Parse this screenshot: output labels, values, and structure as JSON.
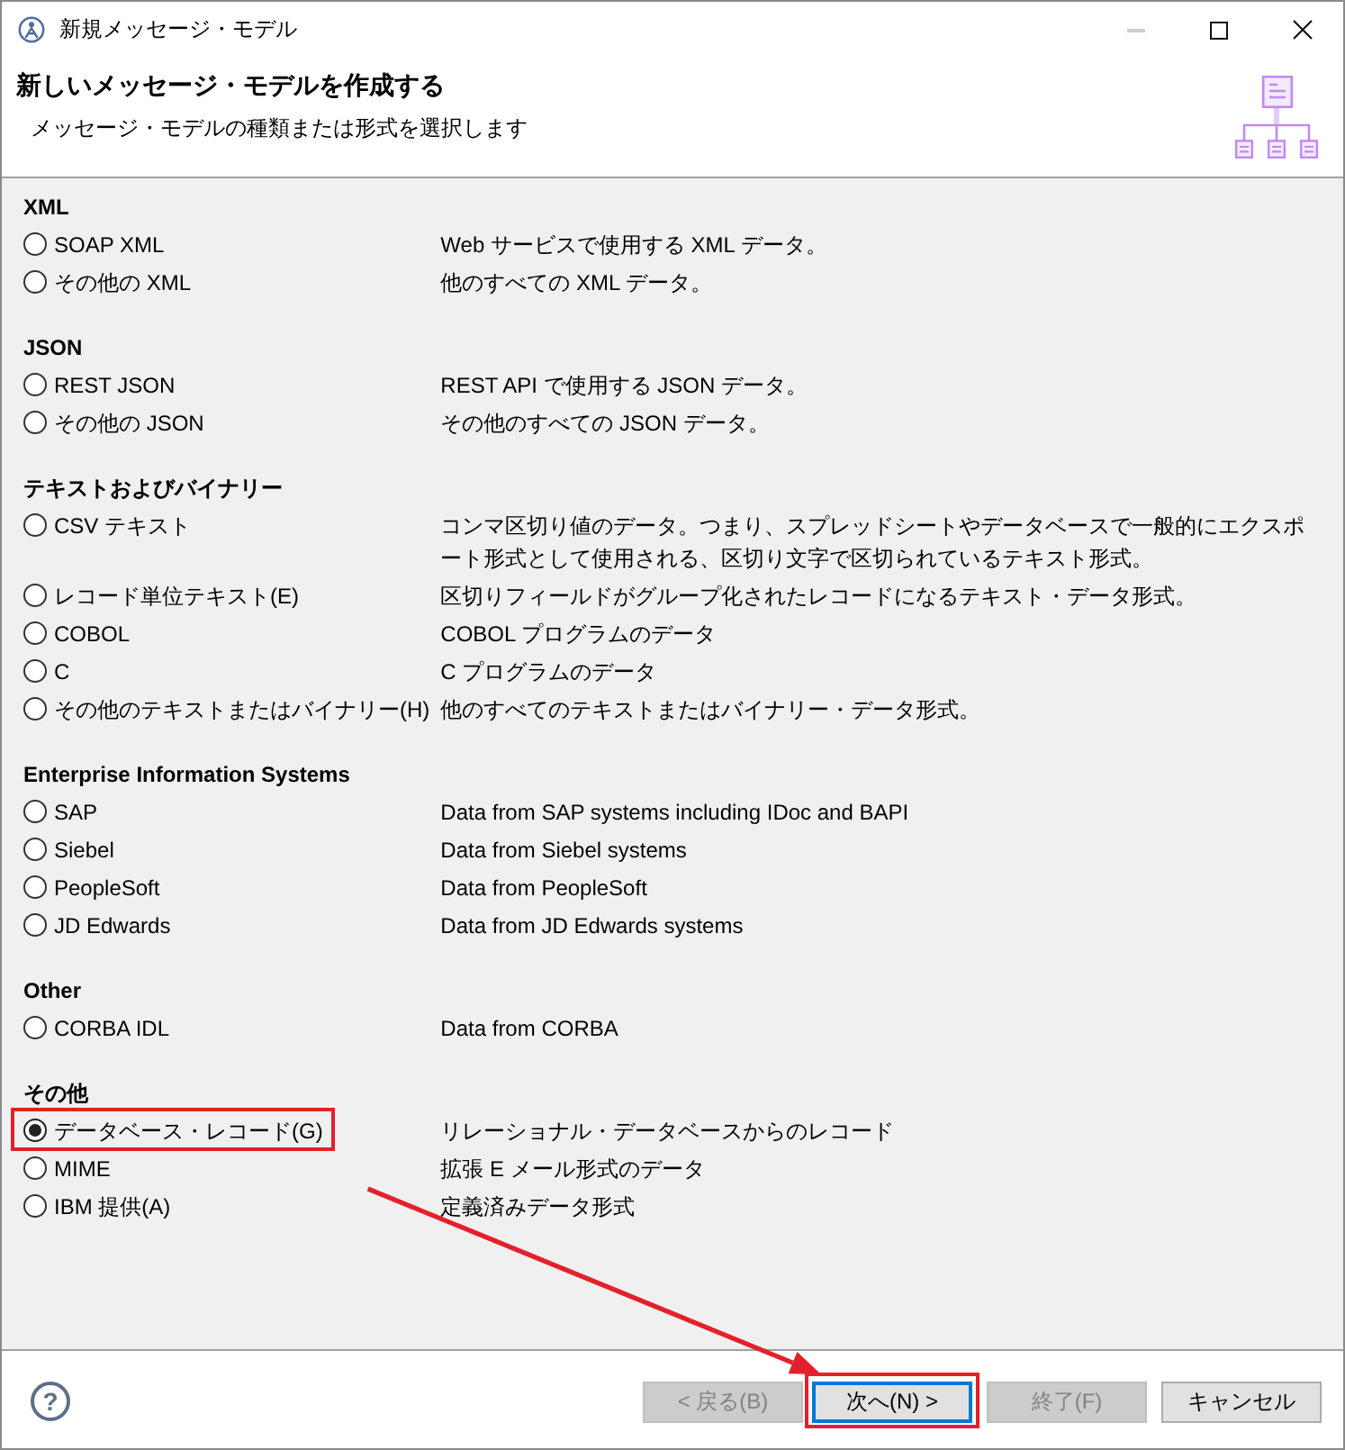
{
  "window": {
    "title": "新規メッセージ・モデル",
    "controls": [
      {
        "kind": "minimize",
        "disabled": true
      },
      {
        "kind": "maximize",
        "disabled": false
      },
      {
        "kind": "close",
        "disabled": false
      }
    ]
  },
  "header": {
    "title": "新しいメッセージ・モデルを作成する",
    "subtitle": "メッセージ・モデルの種類または形式を選択します"
  },
  "groups": [
    {
      "heading": "XML",
      "options": [
        {
          "label": "SOAP XML",
          "description": "Web サービスで使用する XML データ。",
          "selected": false,
          "highlighted": false
        },
        {
          "label": "その他の XML",
          "description": "他のすべての XML データ。",
          "selected": false,
          "highlighted": false
        }
      ]
    },
    {
      "heading": "JSON",
      "options": [
        {
          "label": "REST JSON",
          "description": "REST API で使用する JSON データ。",
          "selected": false,
          "highlighted": false
        },
        {
          "label": "その他の JSON",
          "description": "その他のすべての JSON データ。",
          "selected": false,
          "highlighted": false
        }
      ]
    },
    {
      "heading": "テキストおよびバイナリー",
      "options": [
        {
          "label": "CSV テキスト",
          "description": "コンマ区切り値のデータ。つまり、スプレッドシートやデータベースで一般的にエクスポート形式として使用される、区切り文字で区切られているテキスト形式。",
          "selected": false,
          "highlighted": false
        },
        {
          "label": "レコード単位テキスト(E)",
          "description": "区切りフィールドがグループ化されたレコードになるテキスト・データ形式。",
          "selected": false,
          "highlighted": false
        },
        {
          "label": "COBOL",
          "description": "COBOL プログラムのデータ",
          "selected": false,
          "highlighted": false
        },
        {
          "label": "C",
          "description": "C プログラムのデータ",
          "selected": false,
          "highlighted": false
        },
        {
          "label": "その他のテキストまたはバイナリー(H)",
          "description": "他のすべてのテキストまたはバイナリー・データ形式。",
          "selected": false,
          "highlighted": false
        }
      ]
    },
    {
      "heading": "Enterprise Information Systems",
      "options": [
        {
          "label": "SAP",
          "description": "Data from SAP systems including IDoc and BAPI",
          "selected": false,
          "highlighted": false
        },
        {
          "label": "Siebel",
          "description": "Data from Siebel systems",
          "selected": false,
          "highlighted": false
        },
        {
          "label": "PeopleSoft",
          "description": "Data from PeopleSoft",
          "selected": false,
          "highlighted": false
        },
        {
          "label": "JD Edwards",
          "description": "Data from JD Edwards systems",
          "selected": false,
          "highlighted": false
        }
      ]
    },
    {
      "heading": "Other",
      "options": [
        {
          "label": "CORBA IDL",
          "description": "Data from CORBA",
          "selected": false,
          "highlighted": false
        }
      ]
    },
    {
      "heading": "その他",
      "options": [
        {
          "label": "データベース・レコード(G)",
          "description": "リレーショナル・データベースからのレコード",
          "selected": true,
          "highlighted": true
        },
        {
          "label": "MIME",
          "description": "拡張 E メール形式のデータ",
          "selected": false,
          "highlighted": false
        },
        {
          "label": "IBM 提供(A)",
          "description": "定義済みデータ形式",
          "selected": false,
          "highlighted": false
        }
      ]
    }
  ],
  "help_button": {
    "label": "?"
  },
  "buttons": [
    {
      "label": "< 戻る(B)",
      "disabled": true,
      "focused": false,
      "highlighted": false
    },
    {
      "label": "次へ(N) >",
      "disabled": false,
      "focused": true,
      "highlighted": true
    },
    {
      "label": "終了(F)",
      "disabled": true,
      "focused": false,
      "highlighted": false
    },
    {
      "label": "キャンセル",
      "disabled": false,
      "focused": false,
      "highlighted": false
    }
  ]
}
